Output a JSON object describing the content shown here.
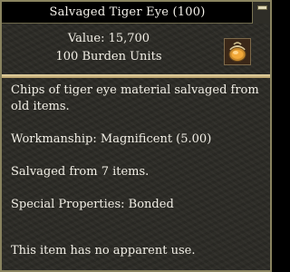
{
  "window": {
    "title": "Salvaged Tiger Eye (100)"
  },
  "item": {
    "value_text": "Value: 15,700",
    "burden_text": "100 Burden Units",
    "icon": "salvage-bag-icon"
  },
  "description": {
    "summary": "Chips of tiger eye material salvaged from old items.",
    "workmanship": "Workmanship: Magnificent (5.00)",
    "salvaged_from": "Salvaged from 7 items.",
    "special_properties": "Special Properties: Bonded",
    "use": "This item has no apparent use."
  },
  "colors": {
    "panel_bg": "#2b2a25",
    "title_bg": "#000000",
    "divider": "#d9c48e",
    "text": "#f2efe6"
  }
}
